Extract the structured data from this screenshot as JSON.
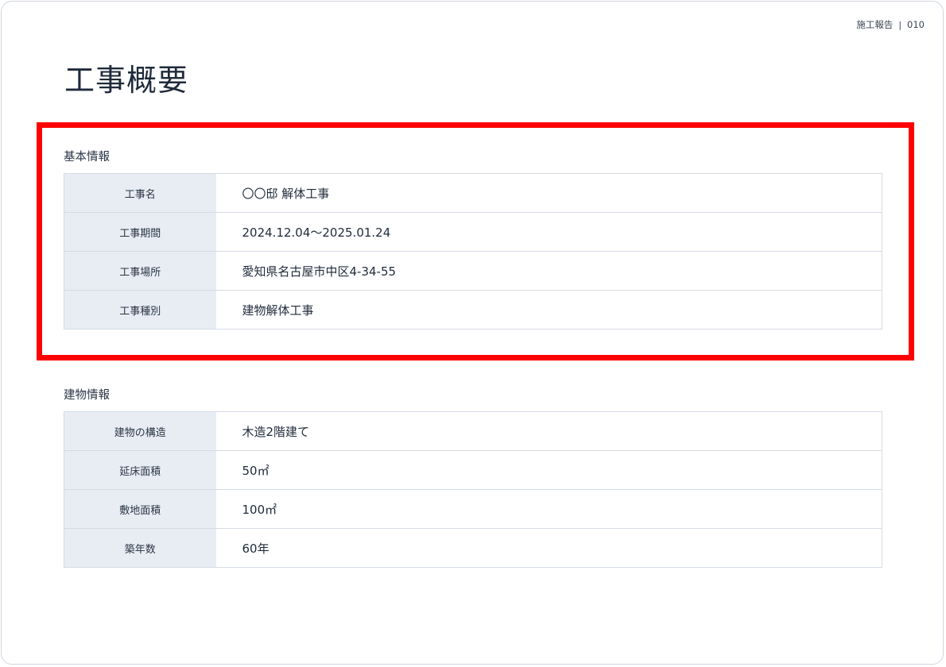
{
  "header": {
    "doc_label": "施工報告",
    "separator": "|",
    "page_number": "010"
  },
  "page_title": "工事概要",
  "basic_info": {
    "title": "基本情報",
    "rows": [
      {
        "label": "工事名",
        "value": "〇〇邸 解体工事"
      },
      {
        "label": "工事期間",
        "value": "2024.12.04〜2025.01.24"
      },
      {
        "label": "工事場所",
        "value": "愛知県名古屋市中区4-34-55"
      },
      {
        "label": "工事種別",
        "value": "建物解体工事"
      }
    ]
  },
  "building_info": {
    "title": "建物情報",
    "rows": [
      {
        "label": "建物の構造",
        "value": "木造2階建て"
      },
      {
        "label": "延床面積",
        "value": "50㎡"
      },
      {
        "label": "敷地面積",
        "value": "100㎡"
      },
      {
        "label": "築年数",
        "value": "60年"
      }
    ]
  },
  "colors": {
    "highlight_border": "#ff0000",
    "label_bg": "#e8edf4",
    "table_border": "#d5dbe3",
    "text_dark": "#1f2a3a"
  }
}
